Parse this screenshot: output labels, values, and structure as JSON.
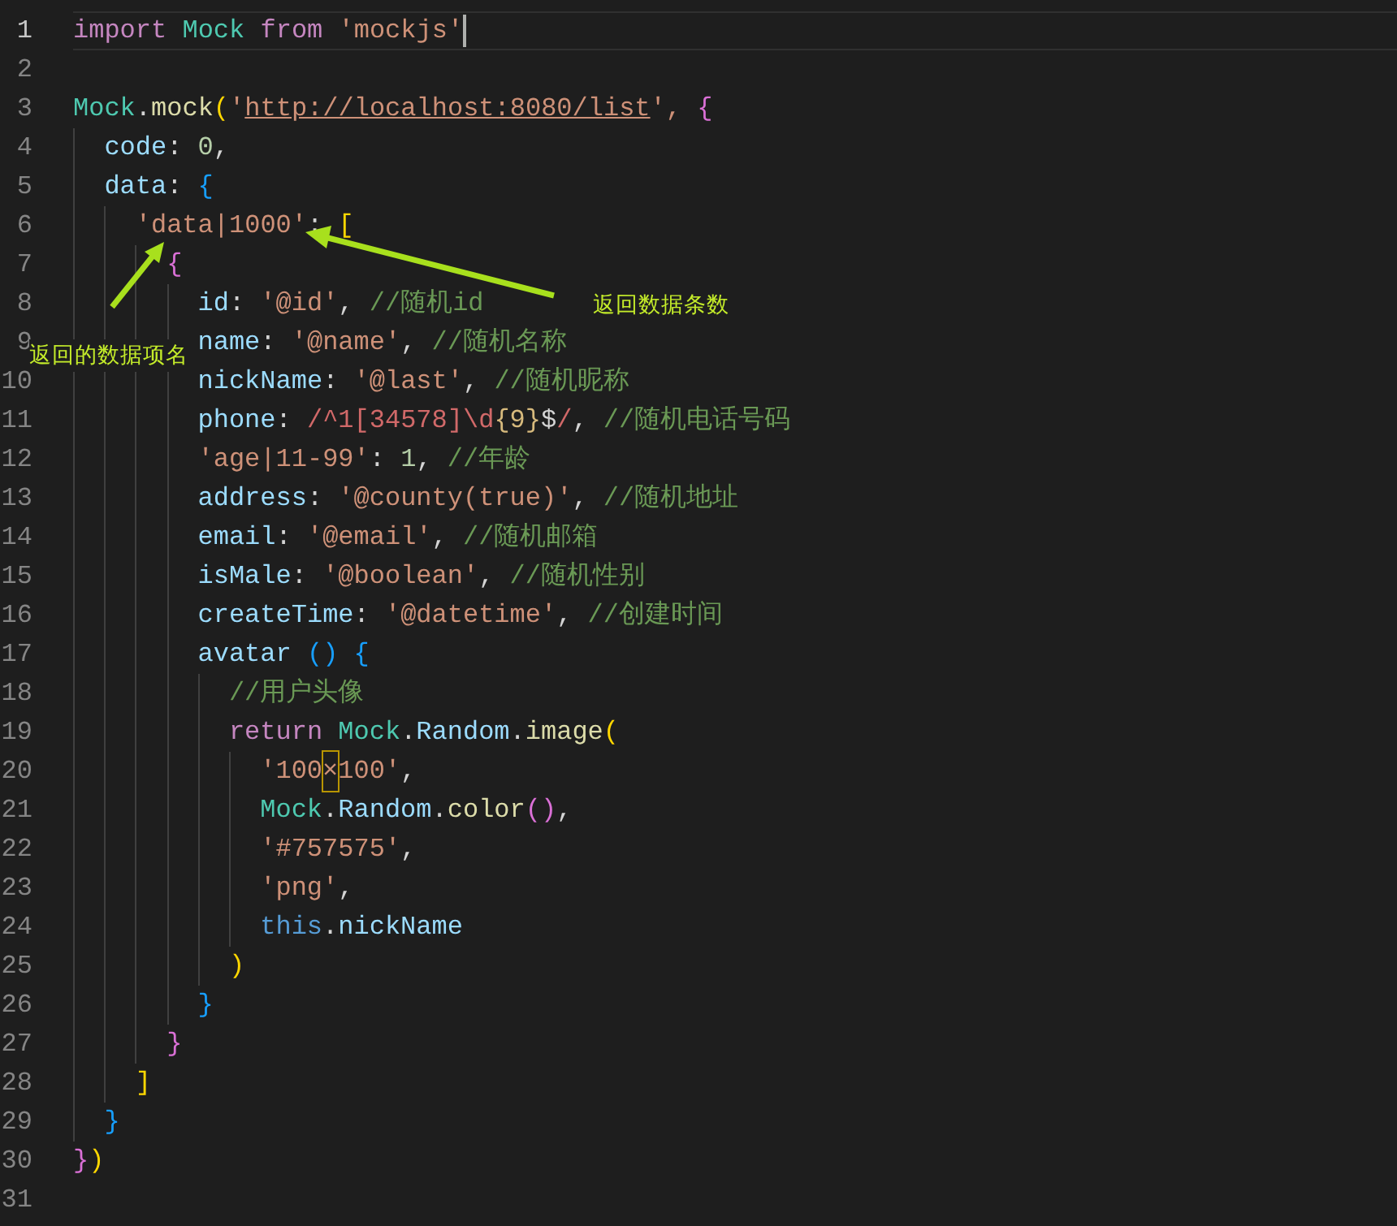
{
  "editor": {
    "lines": [
      {
        "number": "1",
        "current": true,
        "tokens": [
          {
            "text": "import ",
            "kind": "kw"
          },
          {
            "text": "Mock ",
            "kind": "cls"
          },
          {
            "text": "from ",
            "kind": "kw"
          },
          {
            "text": "'mockjs'",
            "kind": "str"
          }
        ]
      },
      {
        "number": "2",
        "current": false
      },
      {
        "number": "3",
        "current": false,
        "tokens": [
          {
            "text": "Mock",
            "kind": "cls"
          },
          {
            "text": ".",
            "kind": "pun"
          },
          {
            "text": "mock",
            "kind": "fn"
          },
          {
            "text": "(",
            "kind": "b1"
          },
          {
            "text": "'",
            "kind": "str"
          },
          {
            "text": "http://localhost:8080/list",
            "kind": "link"
          },
          {
            "text": "', ",
            "kind": "str"
          },
          {
            "text": "{",
            "kind": "b2"
          }
        ],
        "children": [
          {
            "number": "4",
            "current": false,
            "tokens": [
              {
                "text": "code",
                "kind": "var"
              },
              {
                "text": ": ",
                "kind": "pun"
              },
              {
                "text": "0",
                "kind": "num"
              },
              {
                "text": ",",
                "kind": "pun"
              }
            ]
          },
          {
            "number": "5",
            "current": false,
            "tokens": [
              {
                "text": "data",
                "kind": "var"
              },
              {
                "text": ": ",
                "kind": "pun"
              },
              {
                "text": "{",
                "kind": "b3"
              }
            ],
            "children": [
              {
                "number": "6",
                "current": false,
                "tokens": [
                  {
                    "text": "'data|1000'",
                    "kind": "str"
                  },
                  {
                    "text": ": ",
                    "kind": "pun"
                  },
                  {
                    "text": "[",
                    "kind": "b1"
                  }
                ],
                "children": [
                  {
                    "number": "7",
                    "current": false,
                    "tokens": [
                      {
                        "text": "{",
                        "kind": "b2"
                      }
                    ],
                    "children": [
                      {
                        "number": "8",
                        "current": false,
                        "tokens": [
                          {
                            "text": "id",
                            "kind": "var"
                          },
                          {
                            "text": ": ",
                            "kind": "pun"
                          },
                          {
                            "text": "'@id'",
                            "kind": "str"
                          },
                          {
                            "text": ", ",
                            "kind": "pun"
                          },
                          {
                            "text": "//随机id",
                            "kind": "cmt"
                          }
                        ]
                      },
                      {
                        "number": "9",
                        "current": false,
                        "tokens": [
                          {
                            "text": "name",
                            "kind": "var"
                          },
                          {
                            "text": ": ",
                            "kind": "pun"
                          },
                          {
                            "text": "'@name'",
                            "kind": "str"
                          },
                          {
                            "text": ", ",
                            "kind": "pun"
                          },
                          {
                            "text": "//随机名称",
                            "kind": "cmt"
                          }
                        ]
                      },
                      {
                        "number": "10",
                        "current": false,
                        "tokens": [
                          {
                            "text": "nickName",
                            "kind": "var"
                          },
                          {
                            "text": ": ",
                            "kind": "pun"
                          },
                          {
                            "text": "'@last'",
                            "kind": "str"
                          },
                          {
                            "text": ", ",
                            "kind": "pun"
                          },
                          {
                            "text": "//随机昵称",
                            "kind": "cmt"
                          }
                        ]
                      },
                      {
                        "number": "11",
                        "current": false,
                        "tokens": [
                          {
                            "text": "phone",
                            "kind": "var"
                          },
                          {
                            "text": ": ",
                            "kind": "pun"
                          },
                          {
                            "text": "/^1[34578]\\d",
                            "kind": "re"
                          },
                          {
                            "text": "{9}",
                            "kind": "esc"
                          },
                          {
                            "text": "$",
                            "kind": "pun"
                          },
                          {
                            "text": "/",
                            "kind": "re"
                          },
                          {
                            "text": ", ",
                            "kind": "pun"
                          },
                          {
                            "text": "//随机电话号码",
                            "kind": "cmt"
                          }
                        ]
                      },
                      {
                        "number": "12",
                        "current": false,
                        "tokens": [
                          {
                            "text": "'age|11-99'",
                            "kind": "str"
                          },
                          {
                            "text": ": ",
                            "kind": "pun"
                          },
                          {
                            "text": "1",
                            "kind": "num"
                          },
                          {
                            "text": ", ",
                            "kind": "pun"
                          },
                          {
                            "text": "//年龄",
                            "kind": "cmt"
                          }
                        ]
                      },
                      {
                        "number": "13",
                        "current": false,
                        "tokens": [
                          {
                            "text": "address",
                            "kind": "var"
                          },
                          {
                            "text": ": ",
                            "kind": "pun"
                          },
                          {
                            "text": "'@county(true)'",
                            "kind": "str"
                          },
                          {
                            "text": ", ",
                            "kind": "pun"
                          },
                          {
                            "text": "//随机地址",
                            "kind": "cmt"
                          }
                        ]
                      },
                      {
                        "number": "14",
                        "current": false,
                        "tokens": [
                          {
                            "text": "email",
                            "kind": "var"
                          },
                          {
                            "text": ": ",
                            "kind": "pun"
                          },
                          {
                            "text": "'@email'",
                            "kind": "str"
                          },
                          {
                            "text": ", ",
                            "kind": "pun"
                          },
                          {
                            "text": "//随机邮箱",
                            "kind": "cmt"
                          }
                        ]
                      },
                      {
                        "number": "15",
                        "current": false,
                        "tokens": [
                          {
                            "text": "isMale",
                            "kind": "var"
                          },
                          {
                            "text": ": ",
                            "kind": "pun"
                          },
                          {
                            "text": "'@boolean'",
                            "kind": "str"
                          },
                          {
                            "text": ", ",
                            "kind": "pun"
                          },
                          {
                            "text": "//随机性别",
                            "kind": "cmt"
                          }
                        ]
                      },
                      {
                        "number": "16",
                        "current": false,
                        "tokens": [
                          {
                            "text": "createTime",
                            "kind": "var"
                          },
                          {
                            "text": ": ",
                            "kind": "pun"
                          },
                          {
                            "text": "'@datetime'",
                            "kind": "str"
                          },
                          {
                            "text": ", ",
                            "kind": "pun"
                          },
                          {
                            "text": "//创建时间",
                            "kind": "cmt"
                          }
                        ]
                      },
                      {
                        "number": "17",
                        "current": false,
                        "tokens": [
                          {
                            "text": "avatar ",
                            "kind": "var"
                          },
                          {
                            "text": "()",
                            "kind": "b3"
                          },
                          {
                            "text": " {",
                            "kind": "b3"
                          }
                        ],
                        "children": [
                          {
                            "number": "18",
                            "current": false,
                            "tokens": [
                              {
                                "text": "//用户头像",
                                "kind": "cmt"
                              }
                            ]
                          },
                          {
                            "number": "19",
                            "current": false,
                            "tokens": [
                              {
                                "text": "return ",
                                "kind": "kw"
                              },
                              {
                                "text": "Mock",
                                "kind": "cls"
                              },
                              {
                                "text": ".",
                                "kind": "pun"
                              },
                              {
                                "text": "Random",
                                "kind": "var"
                              },
                              {
                                "text": ".",
                                "kind": "pun"
                              },
                              {
                                "text": "image",
                                "kind": "fn"
                              },
                              {
                                "text": "(",
                                "kind": "b1"
                              }
                            ],
                            "children": [
                              {
                                "number": "20",
                                "current": false,
                                "tokens": [
                                  {
                                    "text": "'100",
                                    "kind": "str"
                                  },
                                  {
                                    "text": "×",
                                    "kind": "hl"
                                  },
                                  {
                                    "text": "100'",
                                    "kind": "str"
                                  },
                                  {
                                    "text": ",",
                                    "kind": "pun"
                                  }
                                ]
                              },
                              {
                                "number": "21",
                                "current": false,
                                "tokens": [
                                  {
                                    "text": "Mock",
                                    "kind": "cls"
                                  },
                                  {
                                    "text": ".",
                                    "kind": "pun"
                                  },
                                  {
                                    "text": "Random",
                                    "kind": "var"
                                  },
                                  {
                                    "text": ".",
                                    "kind": "pun"
                                  },
                                  {
                                    "text": "color",
                                    "kind": "fn"
                                  },
                                  {
                                    "text": "()",
                                    "kind": "b2"
                                  },
                                  {
                                    "text": ",",
                                    "kind": "pun"
                                  }
                                ]
                              },
                              {
                                "number": "22",
                                "current": false,
                                "tokens": [
                                  {
                                    "text": "'#757575'",
                                    "kind": "str"
                                  },
                                  {
                                    "text": ",",
                                    "kind": "pun"
                                  }
                                ]
                              },
                              {
                                "number": "23",
                                "current": false,
                                "tokens": [
                                  {
                                    "text": "'png'",
                                    "kind": "str"
                                  },
                                  {
                                    "text": ",",
                                    "kind": "pun"
                                  }
                                ]
                              },
                              {
                                "number": "24",
                                "current": false,
                                "tokens": [
                                  {
                                    "text": "this",
                                    "kind": "this"
                                  },
                                  {
                                    "text": ".",
                                    "kind": "pun"
                                  },
                                  {
                                    "text": "nickName",
                                    "kind": "var"
                                  }
                                ]
                              }
                            ]
                          },
                          {
                            "number": "25",
                            "current": false,
                            "tokens": [
                              {
                                "text": ")",
                                "kind": "b1"
                              }
                            ]
                          }
                        ]
                      },
                      {
                        "number": "26",
                        "current": false,
                        "tokens": [
                          {
                            "text": "}",
                            "kind": "b3"
                          }
                        ]
                      }
                    ]
                  },
                  {
                    "number": "27",
                    "current": false,
                    "tokens": [
                      {
                        "text": "}",
                        "kind": "b2"
                      }
                    ]
                  }
                ]
              },
              {
                "number": "28",
                "current": false,
                "tokens": [
                  {
                    "text": "]",
                    "kind": "b1"
                  }
                ]
              }
            ]
          },
          {
            "number": "29",
            "current": false,
            "tokens": [
              {
                "text": "}",
                "kind": "b3"
              }
            ]
          }
        ]
      },
      {
        "number": "30",
        "current": false,
        "tokens": [
          {
            "text": "}",
            "kind": "b2"
          },
          {
            "text": ")",
            "kind": "b1"
          }
        ]
      },
      {
        "number": "31",
        "current": false
      }
    ]
  },
  "annotations": [
    {
      "kind": "item_name",
      "text": "返回的数据项名"
    },
    {
      "kind": "count",
      "text": "返回数据条数"
    }
  ]
}
